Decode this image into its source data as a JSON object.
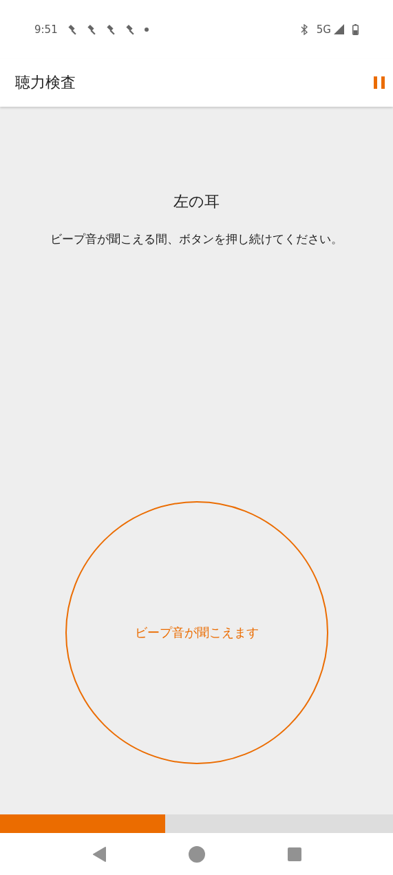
{
  "status_bar": {
    "time": "9:51",
    "network": "5G"
  },
  "app_bar": {
    "title": "聴力検査"
  },
  "test": {
    "ear": "左の耳",
    "instruction": "ビープ音が聞こえる間、ボタンを押し続けてください。",
    "button_label": "ビープ音が聞こえます"
  },
  "progress": {
    "level": 0.42
  }
}
